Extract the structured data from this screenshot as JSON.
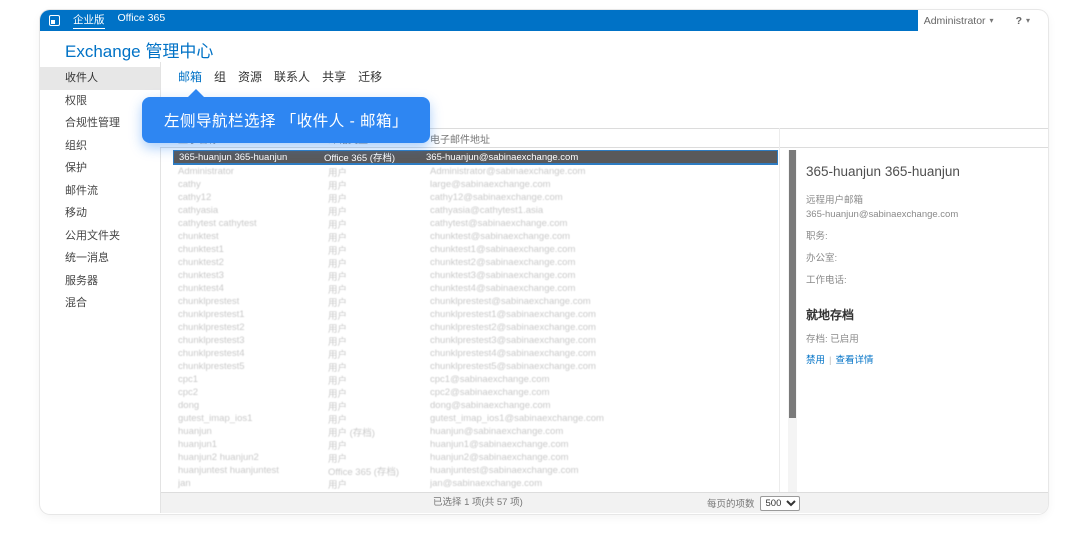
{
  "colors": {
    "accent": "#0072c6",
    "callout": "#2e86f2",
    "selected_row_bg": "#59595b"
  },
  "icons": {
    "office_logo": "office-logo",
    "caret": "▾"
  },
  "chrome": {
    "brand_tabs": [
      {
        "label": "企业版",
        "active": true
      },
      {
        "label": "Office 365",
        "active": false
      }
    ],
    "user_menu": "Administrator",
    "help_menu": "?"
  },
  "header": {
    "title": "Exchange 管理中心"
  },
  "sidebar": {
    "selected_index": 0,
    "items": [
      "收件人",
      "权限",
      "合规性管理",
      "组织",
      "保护",
      "邮件流",
      "移动",
      "公用文件夹",
      "统一消息",
      "服务器",
      "混合"
    ]
  },
  "tabs": {
    "selected_index": 0,
    "items": [
      "邮箱",
      "组",
      "资源",
      "联系人",
      "共享",
      "迁移"
    ]
  },
  "callout": {
    "text": "左侧导航栏选择 「收件人 - 邮箱」"
  },
  "table": {
    "columns": [
      "显示名称",
      "邮箱类型",
      "电子邮件地址"
    ],
    "selected_row": {
      "name": "365-huanjun 365-huanjun",
      "type": "Office 365 (存档)",
      "email": "365-huanjun@sabinaexchange.com"
    },
    "rows": [
      {
        "name": "Administrator",
        "type": "用户",
        "email": "Administrator@sabinaexchange.com"
      },
      {
        "name": "cathy",
        "type": "用户",
        "email": "large@sabinaexchange.com"
      },
      {
        "name": "cathy12",
        "type": "用户",
        "email": "cathy12@sabinaexchange.com"
      },
      {
        "name": "cathyasia",
        "type": "用户",
        "email": "cathyasia@cathytest1.asia"
      },
      {
        "name": "cathytest cathytest",
        "type": "用户",
        "email": "cathytest@sabinaexchange.com"
      },
      {
        "name": "chunktest",
        "type": "用户",
        "email": "chunktest@sabinaexchange.com"
      },
      {
        "name": "chunktest1",
        "type": "用户",
        "email": "chunktest1@sabinaexchange.com"
      },
      {
        "name": "chunktest2",
        "type": "用户",
        "email": "chunktest2@sabinaexchange.com"
      },
      {
        "name": "chunktest3",
        "type": "用户",
        "email": "chunktest3@sabinaexchange.com"
      },
      {
        "name": "chunktest4",
        "type": "用户",
        "email": "chunktest4@sabinaexchange.com"
      },
      {
        "name": "chunklprestest",
        "type": "用户",
        "email": "chunklprestest@sabinaexchange.com"
      },
      {
        "name": "chunklprestest1",
        "type": "用户",
        "email": "chunklprestest1@sabinaexchange.com"
      },
      {
        "name": "chunklprestest2",
        "type": "用户",
        "email": "chunklprestest2@sabinaexchange.com"
      },
      {
        "name": "chunklprestest3",
        "type": "用户",
        "email": "chunklprestest3@sabinaexchange.com"
      },
      {
        "name": "chunklprestest4",
        "type": "用户",
        "email": "chunklprestest4@sabinaexchange.com"
      },
      {
        "name": "chunklprestest5",
        "type": "用户",
        "email": "chunklprestest5@sabinaexchange.com"
      },
      {
        "name": "cpc1",
        "type": "用户",
        "email": "cpc1@sabinaexchange.com"
      },
      {
        "name": "cpc2",
        "type": "用户",
        "email": "cpc2@sabinaexchange.com"
      },
      {
        "name": "dong",
        "type": "用户",
        "email": "dong@sabinaexchange.com"
      },
      {
        "name": "gutest_imap_ios1",
        "type": "用户",
        "email": "gutest_imap_ios1@sabinaexchange.com"
      },
      {
        "name": "huanjun",
        "type": "用户 (存档)",
        "email": "huanjun@sabinaexchange.com"
      },
      {
        "name": "huanjun1",
        "type": "用户",
        "email": "huanjun1@sabinaexchange.com"
      },
      {
        "name": "huanjun2 huanjun2",
        "type": "用户",
        "email": "huanjun2@sabinaexchange.com"
      },
      {
        "name": "huanjuntest huanjuntest",
        "type": "Office 365 (存档)",
        "email": "huanjuntest@sabinaexchange.com"
      },
      {
        "name": "jan",
        "type": "用户",
        "email": "jan@sabinaexchange.com"
      }
    ]
  },
  "details": {
    "title": "365-huanjun 365-huanjun",
    "mailbox_type": "远程用户邮箱",
    "email": "365-huanjun@sabinaexchange.com",
    "fields": [
      "职务:",
      "办公室:",
      "工作电话:"
    ],
    "archive_heading": "就地存档",
    "archive_status": "存档: 已启用",
    "links": [
      "禁用",
      "查看详情"
    ],
    "link_separator": "|"
  },
  "footer": {
    "selection_status": "已选择 1 项(共 57 项)",
    "page_size_label": "每页的项数",
    "page_size": "500"
  }
}
